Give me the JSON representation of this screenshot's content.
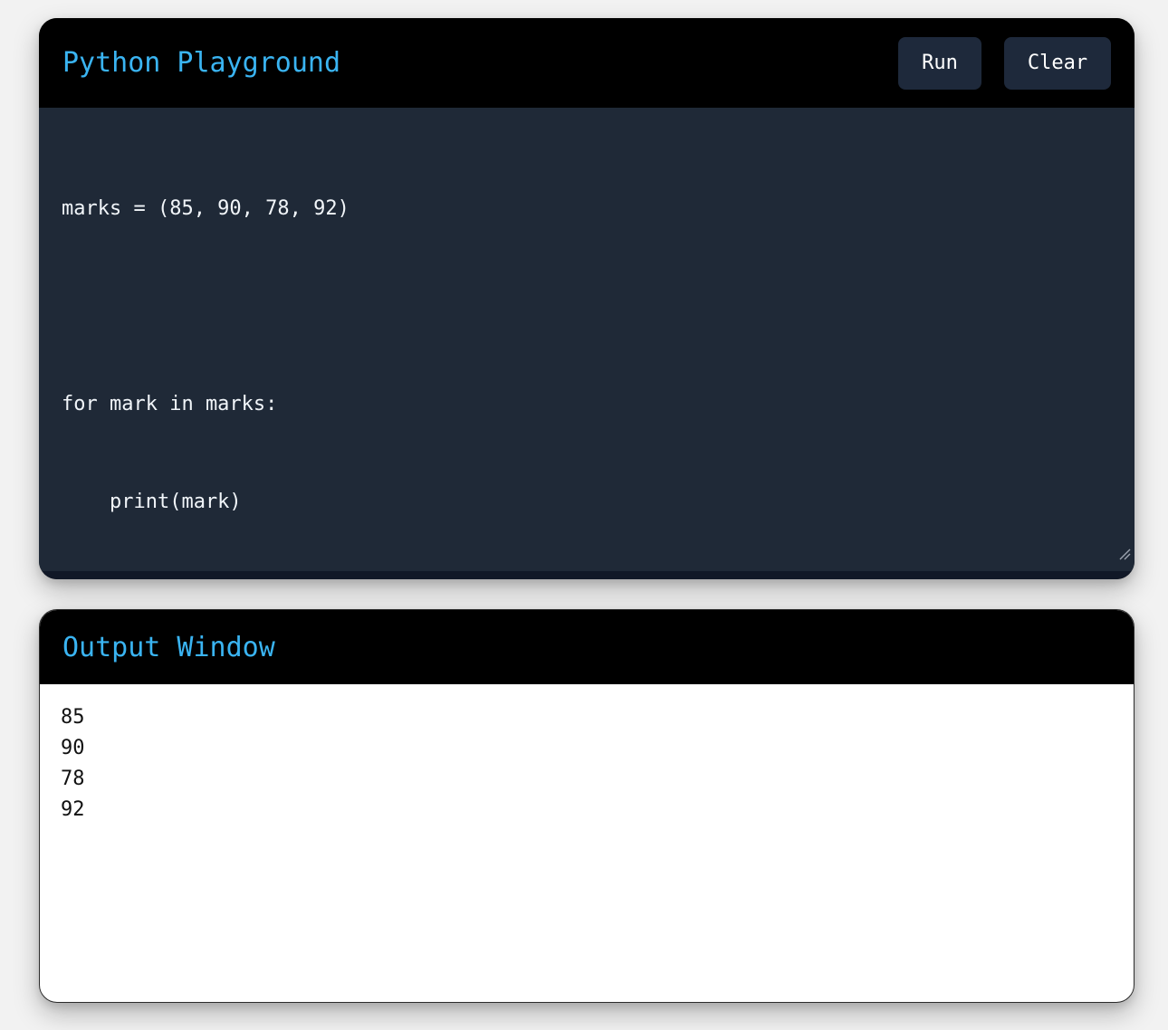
{
  "editor": {
    "title": "Python Playground",
    "run_label": "Run",
    "clear_label": "Clear",
    "code_lines": [
      "marks = (85, 90, 78, 92)",
      "",
      "for mark in marks:",
      "    print(mark)"
    ]
  },
  "output": {
    "title": "Output Window",
    "lines": [
      "85",
      "90",
      "78",
      "92"
    ]
  },
  "colors": {
    "accent": "#3ab4f2",
    "header_bg": "#000000",
    "editor_bg": "#1f2937",
    "button_bg": "#1e293b"
  }
}
